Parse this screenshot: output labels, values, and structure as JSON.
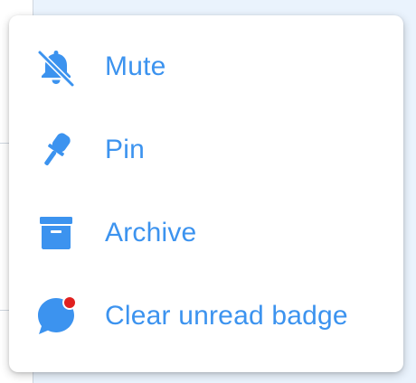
{
  "menu": {
    "items": [
      {
        "label": "Mute",
        "icon": "bell-off-icon"
      },
      {
        "label": "Pin",
        "icon": "pin-icon"
      },
      {
        "label": "Archive",
        "icon": "archive-icon"
      },
      {
        "label": "Clear unread badge",
        "icon": "chat-bubble-badge-icon"
      }
    ]
  },
  "colors": {
    "accent": "#3c93ef",
    "badge": "#e0201f",
    "background": "#eaf3fd",
    "menu_background": "#ffffff"
  }
}
